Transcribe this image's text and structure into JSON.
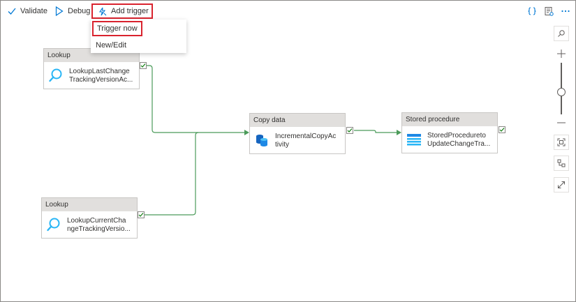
{
  "toolbar": {
    "validate_label": "Validate",
    "debug_label": "Debug",
    "add_trigger_label": "Add trigger",
    "right_icons": [
      "code-icon",
      "properties-icon",
      "more-icon"
    ]
  },
  "trigger_menu": {
    "items": [
      {
        "label": "Trigger now"
      },
      {
        "label": "New/Edit"
      }
    ]
  },
  "activities": [
    {
      "type": "Lookup",
      "name": "LookupLastChange\nTrackingVersionAc...",
      "icon": "lookup-icon"
    },
    {
      "type": "Lookup",
      "name": "LookupCurrentCha\nngeTrackingVersio...",
      "icon": "lookup-icon"
    },
    {
      "type": "Copy data",
      "name": "IncrementalCopyAc\ntivity",
      "icon": "copy-data-icon"
    },
    {
      "type": "Stored procedure",
      "name": "StoredProcedureto\nUpdateChangeTra...",
      "icon": "stored-procedure-icon"
    }
  ],
  "colors": {
    "highlight": "#d9232e",
    "accent": "#0078d4",
    "connector": "#4b9b5a",
    "header_bg": "#e1dfdd"
  }
}
